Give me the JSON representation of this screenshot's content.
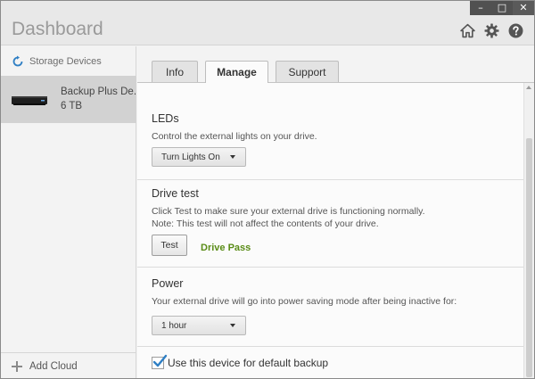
{
  "window": {
    "title": "Dashboard",
    "controls": {
      "minimize": "–",
      "maximize": "□",
      "close": "✕"
    }
  },
  "header_icons": [
    "home-icon",
    "gear-icon",
    "help-icon"
  ],
  "sidebar": {
    "section_label": "Storage Devices",
    "device": {
      "name": "Backup Plus De...",
      "size": "6 TB"
    },
    "add_cloud_label": "Add Cloud"
  },
  "tabs": [
    {
      "label": "Info",
      "active": false
    },
    {
      "label": "Manage",
      "active": true
    },
    {
      "label": "Support",
      "active": false
    }
  ],
  "sections": {
    "leds": {
      "title": "LEDs",
      "description": "Control the external lights on your drive.",
      "dropdown_value": "Turn Lights On"
    },
    "drive_test": {
      "title": "Drive test",
      "description_1": "Click Test to make sure your external drive is functioning normally.",
      "description_2": "Note: This test will not affect the contents of your drive.",
      "button_label": "Test",
      "result": "Drive Pass"
    },
    "power": {
      "title": "Power",
      "description": "Your external drive will go into power saving mode after being inactive for:",
      "dropdown_value": "1 hour"
    }
  },
  "default_backup": {
    "label": "Use this device for default backup",
    "checked": true
  },
  "colors": {
    "pass_green": "#5a8c17",
    "checkmark_blue": "#2f7fc4",
    "selected_device_bg": "#d2d2d2"
  }
}
